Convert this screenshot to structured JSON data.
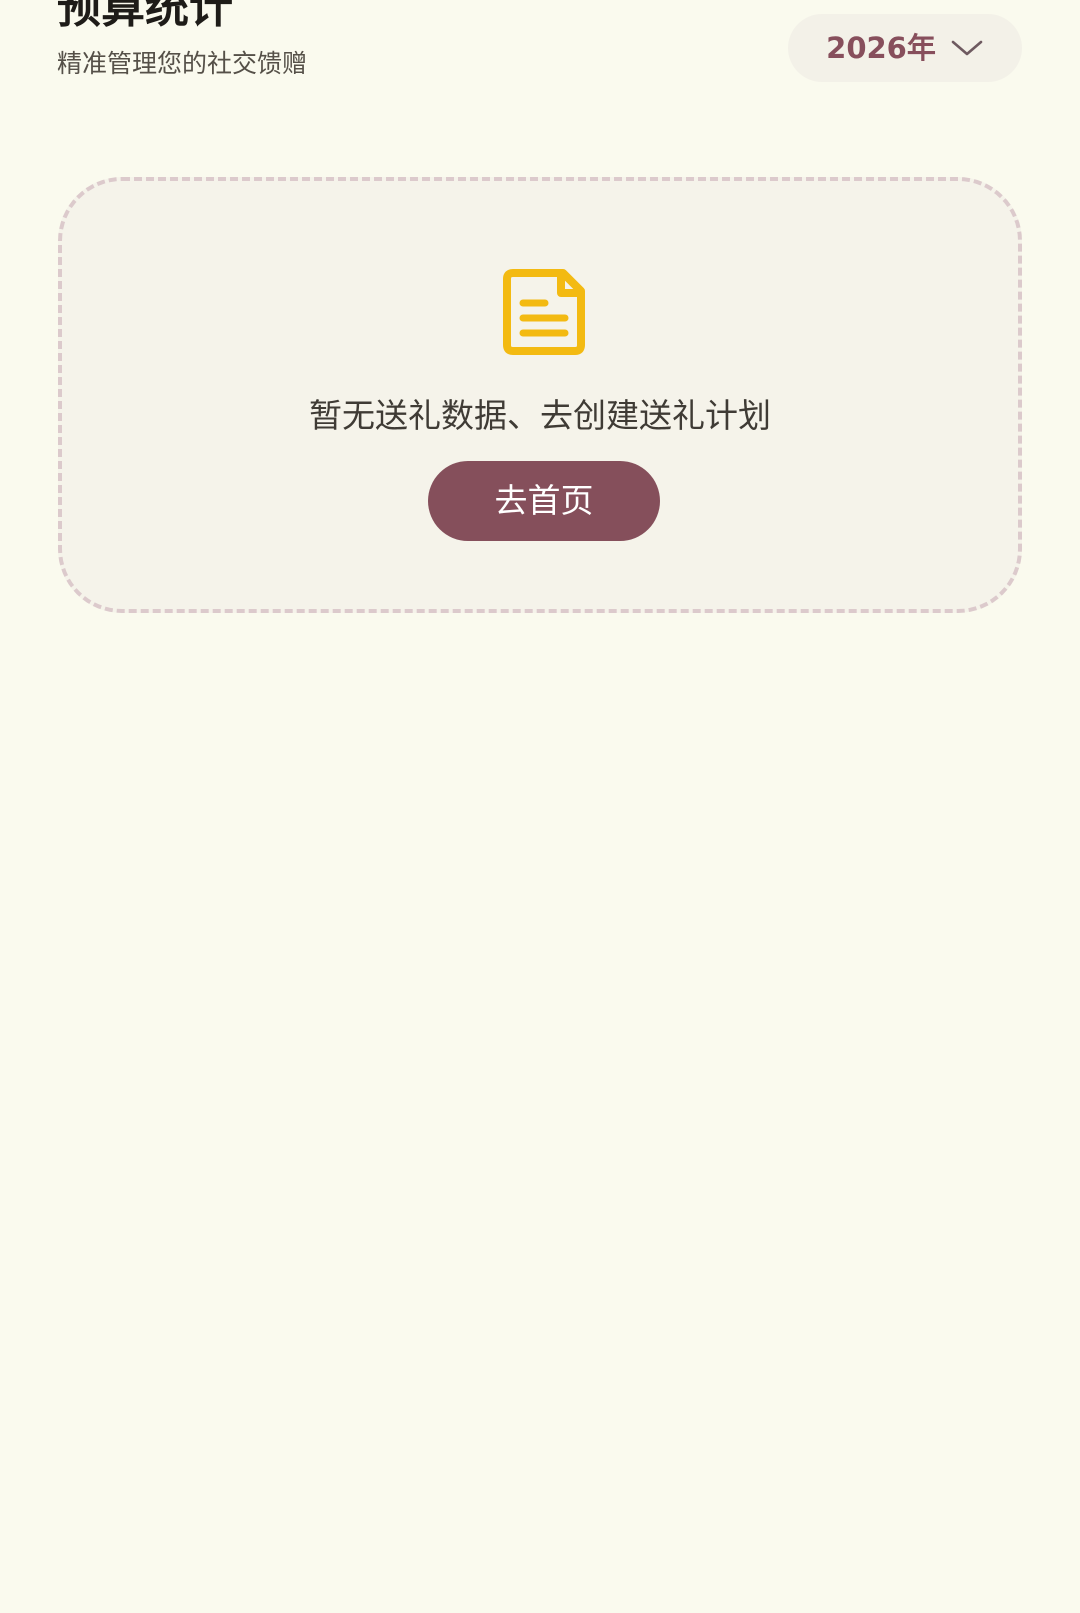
{
  "header": {
    "title": "预算统计",
    "subtitle": "精准管理您的社交馈赠"
  },
  "year_selector": {
    "value": "2026年",
    "icon": "chevron-down-icon"
  },
  "empty_state": {
    "icon": "document-icon",
    "message": "暂无送礼数据、去创建送礼计划",
    "button_label": "去首页"
  },
  "colors": {
    "background": "#fafaee",
    "accent": "#854f5b",
    "icon_yellow": "#f3ba12",
    "card_border": "#dccacc"
  }
}
